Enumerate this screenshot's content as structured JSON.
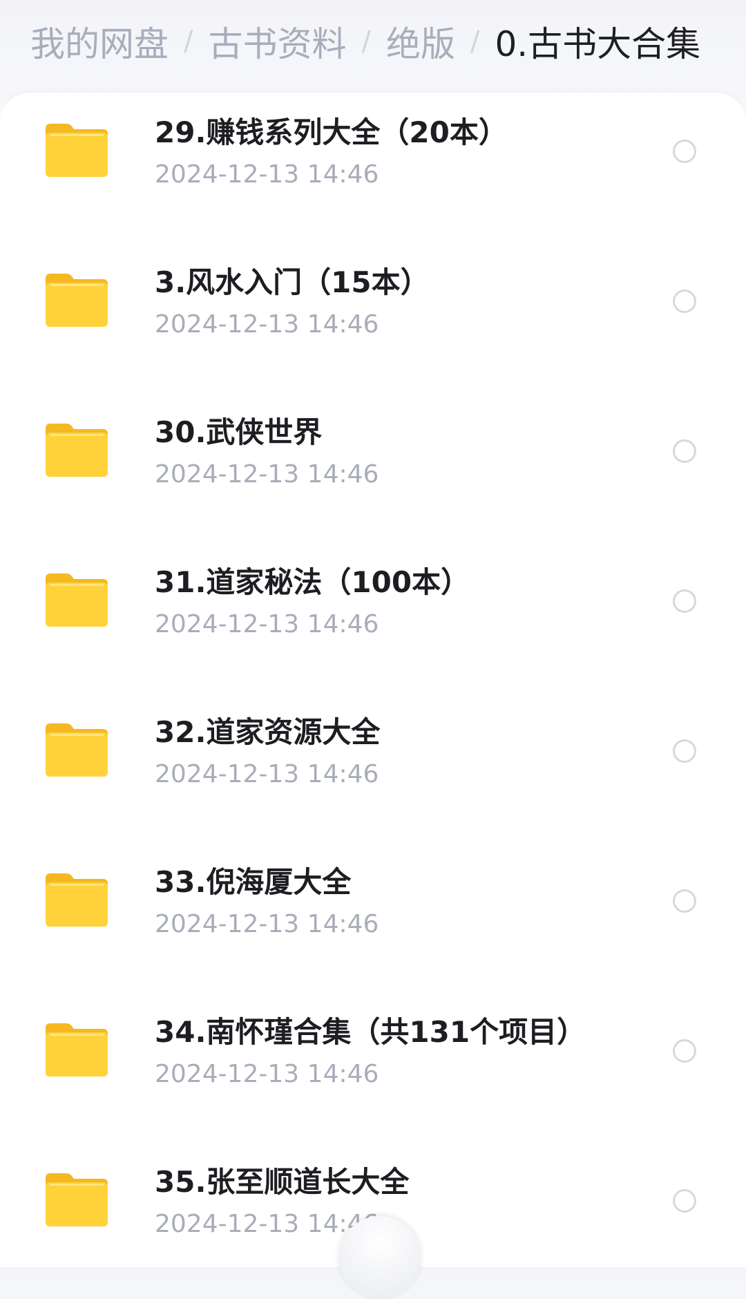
{
  "breadcrumb": {
    "items": [
      "我的网盘",
      "古书资料",
      "绝版"
    ],
    "current": "0.古书大合集",
    "separator": "/"
  },
  "files": [
    {
      "name": "29.赚钱系列大全（20本）",
      "date": "2024-12-13  14:46",
      "icon": "folder-icon"
    },
    {
      "name": "3.风水入门（15本）",
      "date": "2024-12-13  14:46",
      "icon": "folder-icon"
    },
    {
      "name": "30.武侠世界",
      "date": "2024-12-13  14:46",
      "icon": "folder-icon"
    },
    {
      "name": "31.道家秘法（100本）",
      "date": "2024-12-13  14:46",
      "icon": "folder-icon"
    },
    {
      "name": "32.道家资源大全",
      "date": "2024-12-13  14:46",
      "icon": "folder-icon"
    },
    {
      "name": "33.倪海厦大全",
      "date": "2024-12-13  14:46",
      "icon": "folder-icon"
    },
    {
      "name": "34.南怀瑾合集（共131个项目）",
      "date": "2024-12-13  14:46",
      "icon": "folder-icon"
    },
    {
      "name": "35.张至顺道长大全",
      "date": "2024-12-13  14:46",
      "icon": "folder-icon"
    }
  ],
  "colors": {
    "folder": "#ffd23a",
    "text": "#1d1e22",
    "muted": "#a9adb9"
  }
}
